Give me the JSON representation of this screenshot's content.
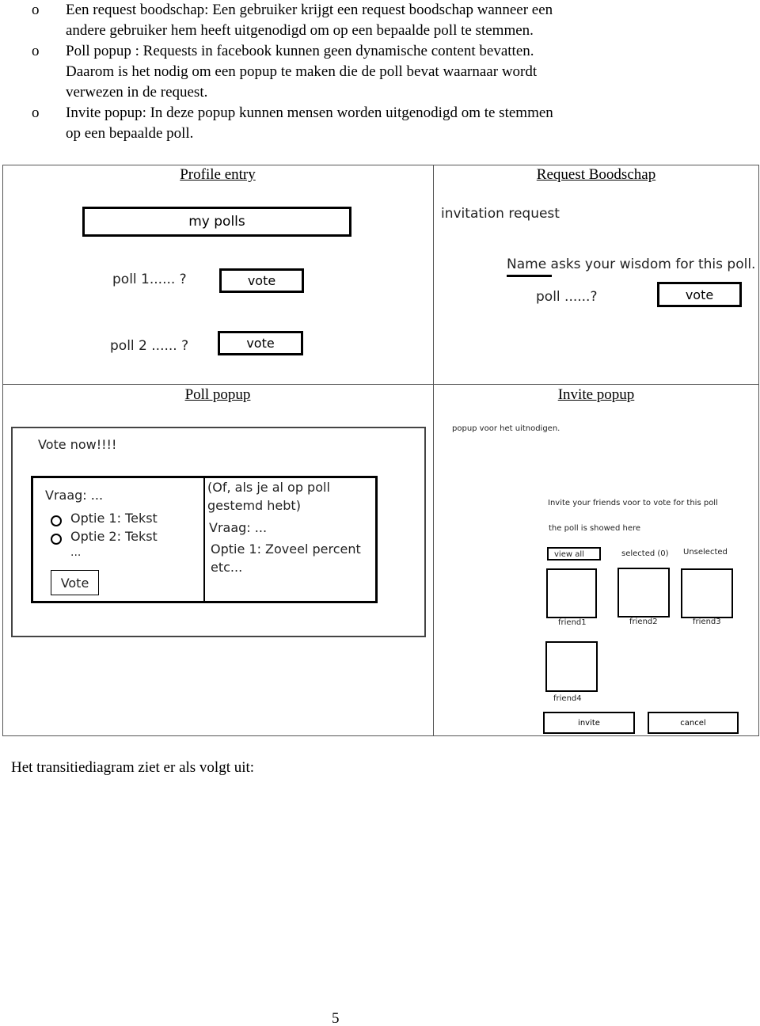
{
  "bullets": [
    {
      "marker": "o",
      "lines": [
        "Een request boodschap: Een gebruiker krijgt een request boodschap wanneer een",
        "andere gebruiker hem heeft uitgenodigd om op een bepaalde poll te stemmen."
      ]
    },
    {
      "marker": "o",
      "lines": [
        "Poll popup : Requests in facebook kunnen geen dynamische content bevatten.",
        "Daarom is het nodig om een popup te maken die de poll bevat waarnaar wordt",
        "verwezen in de request."
      ]
    },
    {
      "marker": "o",
      "lines": [
        "Invite popup: In deze popup kunnen mensen worden uitgenodigd om te stemmen",
        "op een bepaalde poll."
      ]
    }
  ],
  "profile_entry": {
    "caption": "Profile entry",
    "my_polls": "my polls",
    "polls": [
      {
        "label": "poll 1...... ?",
        "button": "vote"
      },
      {
        "label": "poll 2 ...... ?",
        "button": "vote"
      }
    ]
  },
  "request": {
    "caption": "Request Boodschap",
    "title": "invitation request",
    "message": "Name asks your wisdom for this poll.",
    "poll": "poll ......?",
    "button": "vote"
  },
  "poll_popup": {
    "caption": "Poll popup",
    "title": "Vote now!!!!",
    "question": "Vraag: ...",
    "options": [
      "Optie 1: Tekst",
      "Optie 2: Tekst"
    ],
    "more": "...",
    "vote_button": "Vote",
    "result_note_1": "(Of, als je al op poll",
    "result_note_2": "gestemd hebt)",
    "result_question": "Vraag: ...",
    "result_line": "Optie 1: Zoveel percent",
    "result_etc": "etc..."
  },
  "invite_popup": {
    "caption": "Invite popup",
    "title": "popup voor het uitnodigen.",
    "instruction": "Invite your friends voor to vote for this poll",
    "poll_note": "the poll is showed here",
    "view_all": "view all",
    "selected": "selected (0)",
    "unselected": "Unselected",
    "friends": [
      "friend1",
      "friend2",
      "friend3",
      "friend4"
    ],
    "invite": "invite",
    "cancel": "cancel"
  },
  "footer_text": "Het transitiediagram ziet er als volgt uit:",
  "page_number": "5"
}
